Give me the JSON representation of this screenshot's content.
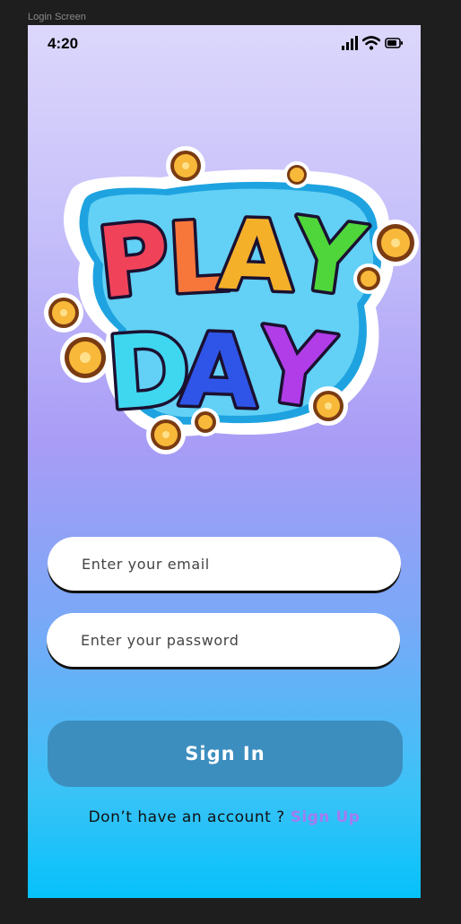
{
  "frame": {
    "label": "Login Screen"
  },
  "status_bar": {
    "time": "4:20",
    "icons": [
      "signal-icon",
      "wifi-icon",
      "battery-icon"
    ]
  },
  "logo": {
    "line1": "PLAY",
    "line2": "DAY",
    "letter_colors": [
      "#f0435a",
      "#f7763a",
      "#f5b02a",
      "#4fd63a",
      "#3fd7f0",
      "#2f55e8",
      "#b03de8"
    ]
  },
  "form": {
    "email_placeholder": "Enter your email",
    "password_placeholder": "Enter your password",
    "signin_label": "Sign In"
  },
  "footer": {
    "prompt": "Don’t have an account ?",
    "signup_label": "Sign Up"
  },
  "colors": {
    "signin_button": "#3c8ebf",
    "signup_link": "#a27cf0",
    "gradient_top": "#dcd7fb",
    "gradient_bottom": "#06c1fb"
  }
}
